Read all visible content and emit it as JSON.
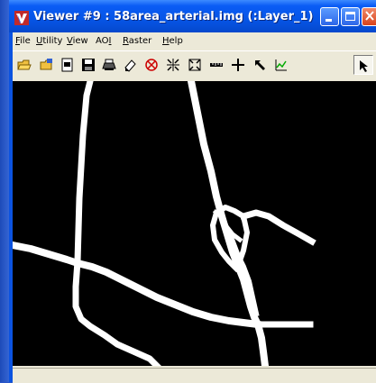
{
  "window": {
    "title": "Viewer #9 : 58area_arterial.img (:Layer_1)",
    "controls": [
      "minimize",
      "maximize",
      "close"
    ]
  },
  "menu": [
    {
      "mnemonic": "F",
      "rest": "ile"
    },
    {
      "mnemonic": "U",
      "rest": "tility"
    },
    {
      "mnemonic": "V",
      "rest": "iew"
    },
    {
      "pre": "AO",
      "mnemonic": "I",
      "rest": ""
    },
    {
      "mnemonic": "R",
      "rest": "aster"
    },
    {
      "mnemonic": "H",
      "rest": "elp"
    }
  ],
  "toolbar": {
    "tools": [
      "open-folder-icon",
      "open-layer-icon",
      "new-icon",
      "save-icon",
      "print-icon",
      "eraser-icon",
      "clear-icon",
      "zoom-in-out-icon",
      "fit-window-icon",
      "measure-icon",
      "inquire-cursor-icon",
      "pan-icon",
      "profile-icon",
      "select-arrow-icon"
    ],
    "selected": "select-arrow-icon"
  },
  "viewer": {
    "layer": "Layer_1",
    "background": "#000000",
    "foreground": "#ffffff"
  },
  "status": {
    "text": ""
  }
}
